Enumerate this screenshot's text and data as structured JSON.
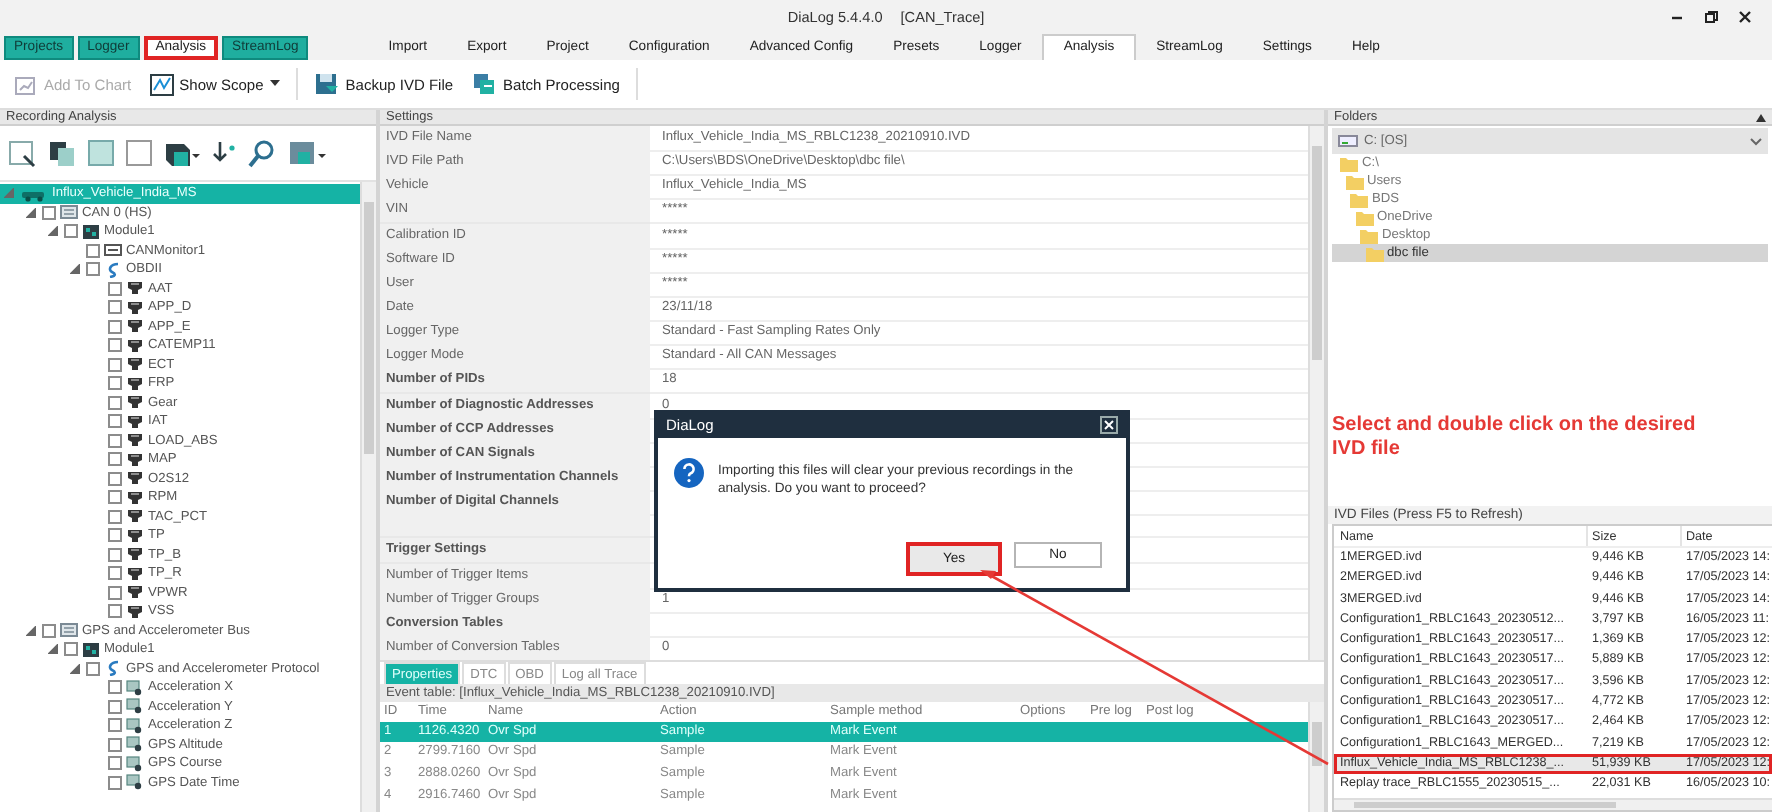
{
  "window": {
    "title": "DiaLog 5.4.4.0",
    "document": "[CAN_Trace]"
  },
  "app_tabs": [
    {
      "label": "Projects",
      "selected": false,
      "highlighted": false
    },
    {
      "label": "Logger",
      "selected": false,
      "highlighted": false
    },
    {
      "label": "Analysis",
      "selected": true,
      "highlighted": true
    },
    {
      "label": "StreamLog",
      "selected": false,
      "highlighted": false
    }
  ],
  "ribbon_tabs": [
    {
      "label": "Import",
      "selected": false
    },
    {
      "label": "Export",
      "selected": false
    },
    {
      "label": "Project",
      "selected": false
    },
    {
      "label": "Configuration",
      "selected": false
    },
    {
      "label": "Advanced Config",
      "selected": false
    },
    {
      "label": "Presets",
      "selected": false
    },
    {
      "label": "Logger",
      "selected": false
    },
    {
      "label": "Analysis",
      "selected": true
    },
    {
      "label": "StreamLog",
      "selected": false
    },
    {
      "label": "Settings",
      "selected": false
    },
    {
      "label": "Help",
      "selected": false
    }
  ],
  "toolbar": [
    {
      "label": "Add To Chart",
      "kind": "chart",
      "disabled": true,
      "dropdown": false
    },
    {
      "label": "Show Scope",
      "kind": "scope",
      "disabled": false,
      "dropdown": true
    },
    {
      "label": "Backup IVD File",
      "kind": "backup",
      "disabled": false,
      "dropdown": false
    },
    {
      "label": "Batch Processing",
      "kind": "batch",
      "disabled": false,
      "dropdown": false
    }
  ],
  "recording_analysis": {
    "title": "Recording Analysis",
    "tree": [
      {
        "label": "Influx_Vehicle_India_MS",
        "kind": "vehicle",
        "selected": true,
        "expanded": true,
        "children": [
          {
            "label": "CAN 0 (HS)",
            "kind": "bus",
            "checked": false,
            "selected": false,
            "expanded": true,
            "children": [
              {
                "label": "Module1",
                "kind": "module",
                "checked": false,
                "selected": false,
                "expanded": true,
                "children": [
                  {
                    "label": "CANMonitor1",
                    "kind": "monitor",
                    "checked": false,
                    "selected": false
                  },
                  {
                    "label": "OBDII",
                    "kind": "protocol",
                    "checked": false,
                    "selected": false,
                    "expanded": true,
                    "children": [
                      {
                        "label": "AAT",
                        "kind": "signal",
                        "checked": false,
                        "selected": false
                      },
                      {
                        "label": "APP_D",
                        "kind": "signal",
                        "checked": false,
                        "selected": false
                      },
                      {
                        "label": "APP_E",
                        "kind": "signal",
                        "checked": false,
                        "selected": false
                      },
                      {
                        "label": "CATEMP11",
                        "kind": "signal",
                        "checked": false,
                        "selected": false
                      },
                      {
                        "label": "ECT",
                        "kind": "signal",
                        "checked": false,
                        "selected": false
                      },
                      {
                        "label": "FRP",
                        "kind": "signal",
                        "checked": false,
                        "selected": false
                      },
                      {
                        "label": "Gear",
                        "kind": "signal",
                        "checked": false,
                        "selected": false
                      },
                      {
                        "label": "IAT",
                        "kind": "signal",
                        "checked": false,
                        "selected": false
                      },
                      {
                        "label": "LOAD_ABS",
                        "kind": "signal",
                        "checked": false,
                        "selected": false
                      },
                      {
                        "label": "MAP",
                        "kind": "signal",
                        "checked": false,
                        "selected": false
                      },
                      {
                        "label": "O2S12",
                        "kind": "signal",
                        "checked": false,
                        "selected": false
                      },
                      {
                        "label": "RPM",
                        "kind": "signal",
                        "checked": false,
                        "selected": false
                      },
                      {
                        "label": "TAC_PCT",
                        "kind": "signal",
                        "checked": false,
                        "selected": false
                      },
                      {
                        "label": "TP",
                        "kind": "signal",
                        "checked": false,
                        "selected": false
                      },
                      {
                        "label": "TP_B",
                        "kind": "signal",
                        "checked": false,
                        "selected": false
                      },
                      {
                        "label": "TP_R",
                        "kind": "signal",
                        "checked": false,
                        "selected": false
                      },
                      {
                        "label": "VPWR",
                        "kind": "signal",
                        "checked": false,
                        "selected": false
                      },
                      {
                        "label": "VSS",
                        "kind": "signal",
                        "checked": false,
                        "selected": false
                      }
                    ]
                  }
                ]
              }
            ]
          },
          {
            "label": "GPS and Accelerometer Bus",
            "kind": "bus",
            "checked": false,
            "selected": false,
            "expanded": true,
            "children": [
              {
                "label": "Module1",
                "kind": "module",
                "checked": false,
                "selected": false,
                "expanded": true,
                "children": [
                  {
                    "label": "GPS and Accelerometer Protocol",
                    "kind": "protocol",
                    "checked": false,
                    "selected": false,
                    "expanded": true,
                    "children": [
                      {
                        "label": "Acceleration X",
                        "kind": "sensor",
                        "checked": false,
                        "selected": false
                      },
                      {
                        "label": "Acceleration Y",
                        "kind": "sensor",
                        "checked": false,
                        "selected": false
                      },
                      {
                        "label": "Acceleration Z",
                        "kind": "sensor",
                        "checked": false,
                        "selected": false
                      },
                      {
                        "label": "GPS Altitude",
                        "kind": "sensor",
                        "checked": false,
                        "selected": false
                      },
                      {
                        "label": "GPS Course",
                        "kind": "sensor",
                        "checked": false,
                        "selected": false
                      },
                      {
                        "label": "GPS Date Time",
                        "kind": "sensor",
                        "checked": false,
                        "selected": false
                      }
                    ]
                  }
                ]
              }
            ]
          }
        ]
      }
    ]
  },
  "settings": {
    "title": "Settings",
    "rows": [
      {
        "kind": "normal",
        "label": "IVD File Name",
        "value": "Influx_Vehicle_India_MS_RBLC1238_20210910.IVD"
      },
      {
        "kind": "normal",
        "label": "IVD File Path",
        "value": "C:\\Users\\BDS\\OneDrive\\Desktop\\dbc file\\"
      },
      {
        "kind": "normal",
        "label": "Vehicle",
        "value": "Influx_Vehicle_India_MS"
      },
      {
        "kind": "normal",
        "label": "VIN",
        "value": "*****"
      },
      {
        "kind": "normal",
        "label": "Calibration ID",
        "value": "*****"
      },
      {
        "kind": "normal",
        "label": "Software ID",
        "value": "*****"
      },
      {
        "kind": "normal",
        "label": "User",
        "value": "*****"
      },
      {
        "kind": "normal",
        "label": "Date",
        "value": "23/11/18"
      },
      {
        "kind": "normal",
        "label": "Logger Type",
        "value": "Standard - Fast Sampling Rates Only"
      },
      {
        "kind": "normal",
        "label": "Logger Mode",
        "value": "Standard - All CAN Messages"
      },
      {
        "kind": "bold",
        "label": "Number of PIDs",
        "value": "18"
      },
      {
        "kind": "bold",
        "label": "Number of Diagnostic Addresses",
        "value": "0"
      },
      {
        "kind": "bold",
        "label": "Number of CCP Addresses"
      },
      {
        "kind": "bold",
        "label": "Number of CAN Signals"
      },
      {
        "kind": "bold",
        "label": "Number of Instrumentation Channels"
      },
      {
        "kind": "bold",
        "label": "Number of Digital Channels"
      },
      {
        "kind": "spacer"
      },
      {
        "kind": "bold",
        "label": "Trigger Settings"
      },
      {
        "kind": "normal",
        "label": "Number of Trigger Items"
      },
      {
        "kind": "normal",
        "label": "Number of Trigger Groups",
        "value": "1"
      },
      {
        "kind": "bold",
        "label": "Conversion Tables"
      },
      {
        "kind": "normal",
        "label": "Number of Conversion Tables",
        "value": "0"
      }
    ]
  },
  "bottom_tabs": [
    {
      "label": "Properties",
      "selected": true
    },
    {
      "label": "DTC",
      "selected": false
    },
    {
      "label": "OBD",
      "selected": false
    },
    {
      "label": "Log all Trace",
      "selected": false
    }
  ],
  "event_table": {
    "title": "Event table: [Influx_Vehicle_India_MS_RBLC1238_20210910.IVD]",
    "columns": [
      "ID",
      "Time",
      "Name",
      "Action",
      "Sample method",
      "Options",
      "Pre log",
      "Post log"
    ],
    "rows": [
      {
        "selected": true,
        "cells": [
          "1",
          "1126.4320",
          "Ovr Spd",
          "Sample",
          "Mark Event"
        ]
      },
      {
        "selected": false,
        "cells": [
          "2",
          "2799.7160",
          "Ovr Spd",
          "Sample",
          "Mark Event"
        ]
      },
      {
        "selected": false,
        "cells": [
          "3",
          "2888.0260",
          "Ovr Spd",
          "Sample",
          "Mark Event"
        ]
      },
      {
        "selected": false,
        "cells": [
          "4",
          "2916.7460",
          "Ovr Spd",
          "Sample",
          "Mark Event"
        ]
      }
    ]
  },
  "folders": {
    "title": "Folders",
    "drive": "C: [OS]",
    "tree": [
      {
        "label": "C:\\",
        "selected": false,
        "children": [
          {
            "label": "Users",
            "selected": false,
            "children": [
              {
                "label": "BDS",
                "selected": false,
                "children": [
                  {
                    "label": "OneDrive",
                    "selected": false,
                    "children": [
                      {
                        "label": "Desktop",
                        "selected": false,
                        "children": [
                          {
                            "label": "dbc file",
                            "selected": true
                          }
                        ]
                      }
                    ]
                  }
                ]
              }
            ]
          }
        ]
      }
    ]
  },
  "annotation": {
    "text": "Select and double click on the desired IVD file"
  },
  "ivd_files": {
    "title": "IVD Files (Press F5 to Refresh)",
    "columns": [
      "Name",
      "Size",
      "Date"
    ],
    "rows": [
      {
        "selected": false,
        "highlighted": false,
        "cells": [
          "1MERGED.ivd",
          "9,446 KB",
          "17/05/2023 14:"
        ]
      },
      {
        "selected": false,
        "highlighted": false,
        "cells": [
          "2MERGED.ivd",
          "9,446 KB",
          "17/05/2023 14:"
        ]
      },
      {
        "selected": false,
        "highlighted": false,
        "cells": [
          "3MERGED.ivd",
          "9,446 KB",
          "17/05/2023 14:"
        ]
      },
      {
        "selected": false,
        "highlighted": false,
        "cells": [
          "Configuration1_RBLC1643_20230512...",
          "3,797 KB",
          "16/05/2023 11:"
        ]
      },
      {
        "selected": false,
        "highlighted": false,
        "cells": [
          "Configuration1_RBLC1643_20230517...",
          "1,369 KB",
          "17/05/2023 12:"
        ]
      },
      {
        "selected": false,
        "highlighted": false,
        "cells": [
          "Configuration1_RBLC1643_20230517...",
          "5,889 KB",
          "17/05/2023 12:"
        ]
      },
      {
        "selected": false,
        "highlighted": false,
        "cells": [
          "Configuration1_RBLC1643_20230517...",
          "3,596 KB",
          "17/05/2023 12:"
        ]
      },
      {
        "selected": false,
        "highlighted": false,
        "cells": [
          "Configuration1_RBLC1643_20230517...",
          "4,772 KB",
          "17/05/2023 12:"
        ]
      },
      {
        "selected": false,
        "highlighted": false,
        "cells": [
          "Configuration1_RBLC1643_20230517...",
          "2,464 KB",
          "17/05/2023 12:"
        ]
      },
      {
        "selected": false,
        "highlighted": false,
        "cells": [
          "Configuration1_RBLC1643_MERGED...",
          "7,219 KB",
          "17/05/2023 12:"
        ]
      },
      {
        "selected": true,
        "highlighted": true,
        "cells": [
          "Influx_Vehicle_India_MS_RBLC1238_...",
          "51,939 KB",
          "17/05/2023 12:"
        ]
      },
      {
        "selected": false,
        "highlighted": false,
        "cells": [
          "Replay trace_RBLC1555_20230515_...",
          "22,031 KB",
          "16/05/2023 10:"
        ]
      }
    ]
  },
  "dialog": {
    "title": "DiaLog",
    "message": "Importing this files will clear your previous recordings in the analysis. Do you want to proceed?",
    "buttons": [
      {
        "label": "Yes",
        "highlighted": true
      },
      {
        "label": "No",
        "highlighted": false
      }
    ]
  }
}
